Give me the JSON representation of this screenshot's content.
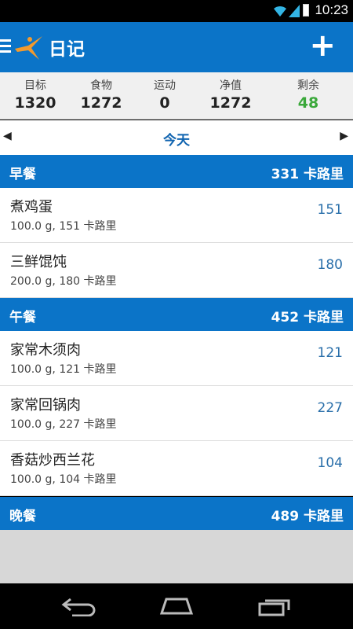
{
  "status": {
    "time": "10:23"
  },
  "appbar": {
    "title": "日记",
    "add_label": "+"
  },
  "summary": [
    {
      "label": "目标",
      "value": "1320",
      "highlight": false
    },
    {
      "label": "食物",
      "value": "1272",
      "highlight": false
    },
    {
      "label": "运动",
      "value": "0",
      "highlight": false
    },
    {
      "label": "净值",
      "value": "1272",
      "highlight": false
    },
    {
      "label": "剩余",
      "value": "48",
      "highlight": true
    }
  ],
  "datebar": {
    "prev": "◀",
    "date": "今天",
    "next": "▶"
  },
  "meals": [
    {
      "name": "早餐",
      "total": "331 卡路里",
      "items": [
        {
          "name": "煮鸡蛋",
          "detail": "100.0 g, 151 卡路里",
          "calories": "151"
        },
        {
          "name": "三鲜馄饨",
          "detail": "200.0 g, 180 卡路里",
          "calories": "180"
        }
      ]
    },
    {
      "name": "午餐",
      "total": "452 卡路里",
      "items": [
        {
          "name": "家常木须肉",
          "detail": "100.0 g, 121 卡路里",
          "calories": "121"
        },
        {
          "name": "家常回锅肉",
          "detail": "100.0 g, 227 卡路里",
          "calories": "227"
        },
        {
          "name": "香菇炒西兰花",
          "detail": "100.0 g, 104 卡路里",
          "calories": "104"
        }
      ]
    },
    {
      "name": "晚餐",
      "total": "489 卡路里",
      "items": []
    }
  ],
  "colors": {
    "primary": "#0b74c8",
    "remaining_green": "#3aa83a",
    "calorie_blue": "#2a6faa"
  },
  "icons": {
    "menu": "menu-icon",
    "logo": "app-logo-icon",
    "add": "add-icon",
    "back": "back-icon",
    "home": "home-icon",
    "recents": "recents-icon"
  }
}
